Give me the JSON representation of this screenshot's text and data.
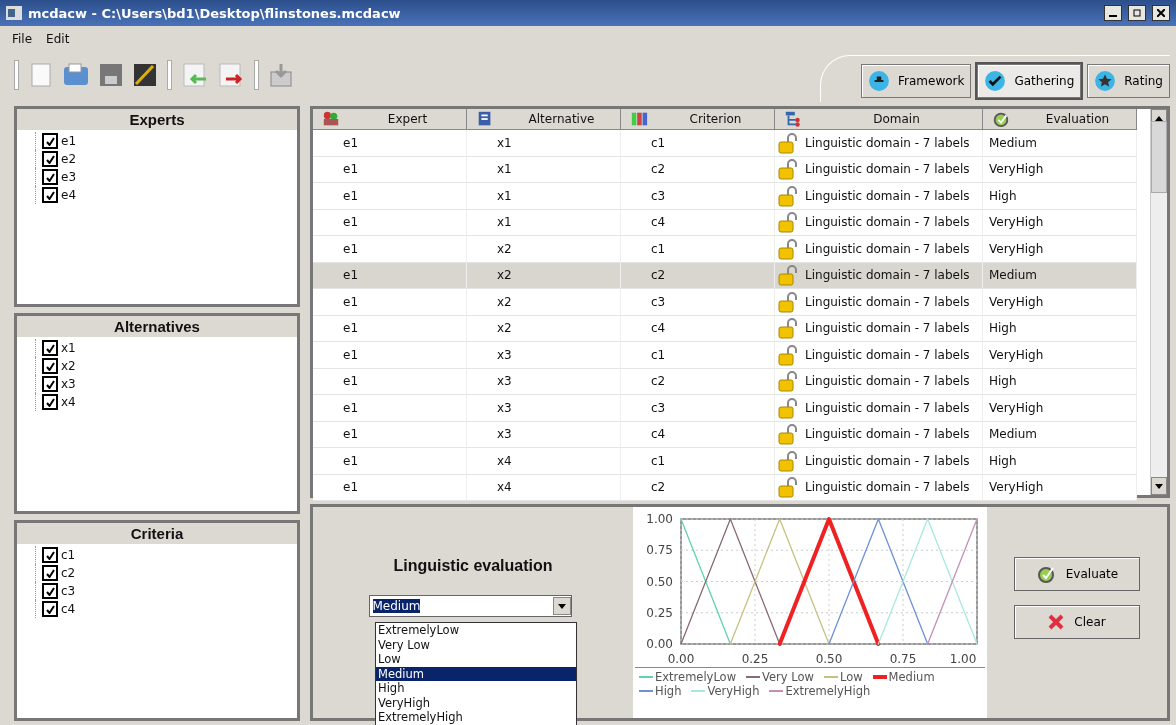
{
  "window": {
    "title": "mcdacw - C:\\Users\\bd1\\Desktop\\flinstones.mcdacw"
  },
  "menu": [
    "File",
    "Edit"
  ],
  "mode_tabs": [
    {
      "label": "Framework",
      "kind": "framework",
      "selected": false
    },
    {
      "label": "Gathering",
      "kind": "gathering",
      "selected": true
    },
    {
      "label": "Rating",
      "kind": "rating",
      "selected": false
    }
  ],
  "panels": [
    {
      "title": "Experts",
      "items": [
        {
          "label": "e1",
          "checked": true
        },
        {
          "label": "e2",
          "checked": true
        },
        {
          "label": "e3",
          "checked": true
        },
        {
          "label": "e4",
          "checked": true
        }
      ]
    },
    {
      "title": "Alternatives",
      "items": [
        {
          "label": "x1",
          "checked": true
        },
        {
          "label": "x2",
          "checked": true
        },
        {
          "label": "x3",
          "checked": true
        },
        {
          "label": "x4",
          "checked": true
        }
      ]
    },
    {
      "title": "Criteria",
      "items": [
        {
          "label": "c1",
          "checked": true
        },
        {
          "label": "c2",
          "checked": true
        },
        {
          "label": "c3",
          "checked": true
        },
        {
          "label": "c4",
          "checked": true
        }
      ]
    }
  ],
  "table": {
    "columns": [
      {
        "label": "Expert",
        "kind": "expert"
      },
      {
        "label": "Alternative",
        "kind": "alternative"
      },
      {
        "label": "Criterion",
        "kind": "criterion"
      },
      {
        "label": "Domain",
        "kind": "domain"
      },
      {
        "label": "Evaluation",
        "kind": "evaluation"
      }
    ],
    "rows": [
      {
        "cells": [
          "e1",
          "x1",
          "c1",
          "Linguistic domain - 7 labels",
          "Medium"
        ],
        "selected": false
      },
      {
        "cells": [
          "e1",
          "x1",
          "c2",
          "Linguistic domain - 7 labels",
          "VeryHigh"
        ],
        "selected": false
      },
      {
        "cells": [
          "e1",
          "x1",
          "c3",
          "Linguistic domain - 7 labels",
          "High"
        ],
        "selected": false
      },
      {
        "cells": [
          "e1",
          "x1",
          "c4",
          "Linguistic domain - 7 labels",
          "VeryHigh"
        ],
        "selected": false
      },
      {
        "cells": [
          "e1",
          "x2",
          "c1",
          "Linguistic domain - 7 labels",
          "VeryHigh"
        ],
        "selected": false
      },
      {
        "cells": [
          "e1",
          "x2",
          "c2",
          "Linguistic domain - 7 labels",
          "Medium"
        ],
        "selected": true
      },
      {
        "cells": [
          "e1",
          "x2",
          "c3",
          "Linguistic domain - 7 labels",
          "VeryHigh"
        ],
        "selected": false
      },
      {
        "cells": [
          "e1",
          "x2",
          "c4",
          "Linguistic domain - 7 labels",
          "High"
        ],
        "selected": false
      },
      {
        "cells": [
          "e1",
          "x3",
          "c1",
          "Linguistic domain - 7 labels",
          "VeryHigh"
        ],
        "selected": false
      },
      {
        "cells": [
          "e1",
          "x3",
          "c2",
          "Linguistic domain - 7 labels",
          "High"
        ],
        "selected": false
      },
      {
        "cells": [
          "e1",
          "x3",
          "c3",
          "Linguistic domain - 7 labels",
          "VeryHigh"
        ],
        "selected": false
      },
      {
        "cells": [
          "e1",
          "x3",
          "c4",
          "Linguistic domain - 7 labels",
          "Medium"
        ],
        "selected": false
      },
      {
        "cells": [
          "e1",
          "x4",
          "c1",
          "Linguistic domain - 7 labels",
          "High"
        ],
        "selected": false
      },
      {
        "cells": [
          "e1",
          "x4",
          "c2",
          "Linguistic domain - 7 labels",
          "VeryHigh"
        ],
        "selected": false
      }
    ]
  },
  "evaluation": {
    "title": "Linguistic evaluation",
    "value": "Medium",
    "options": [
      {
        "label": "ExtremelyLow",
        "selected": false
      },
      {
        "label": "Very Low",
        "selected": false
      },
      {
        "label": "Low",
        "selected": false
      },
      {
        "label": "Medium",
        "selected": true
      },
      {
        "label": "High",
        "selected": false
      },
      {
        "label": "VeryHigh",
        "selected": false
      },
      {
        "label": "ExtremelyHigh",
        "selected": false
      }
    ],
    "chart_data": {
      "type": "line",
      "grid": true,
      "legend": true,
      "x": [
        0,
        0.1667,
        0.3333,
        0.5,
        0.6667,
        0.8333,
        1
      ],
      "xlim": [
        0,
        1
      ],
      "ylim": [
        0,
        1
      ],
      "xticks": [
        {
          "value": 0,
          "label": "0.00"
        },
        {
          "value": 0.25,
          "label": "0.25"
        },
        {
          "value": 0.5,
          "label": "0.50"
        },
        {
          "value": 0.75,
          "label": "0.75"
        },
        {
          "value": 1,
          "label": "1.00"
        }
      ],
      "yticks": [
        {
          "value": 0,
          "label": "0.00"
        },
        {
          "value": 0.25,
          "label": "0.25"
        },
        {
          "value": 0.5,
          "label": "0.50"
        },
        {
          "value": 0.75,
          "label": "0.75"
        },
        {
          "value": 1,
          "label": "1.00"
        }
      ],
      "series": [
        {
          "name": "ExtremelyLow",
          "color": "#5fd3b0",
          "values": [
            1,
            0,
            null,
            null,
            null,
            null,
            null
          ]
        },
        {
          "name": "Very Low",
          "color": "#8a6a72",
          "values": [
            0,
            1,
            0,
            null,
            null,
            null,
            null
          ]
        },
        {
          "name": "Low",
          "color": "#c8c080",
          "values": [
            null,
            0,
            1,
            0,
            null,
            null,
            null
          ]
        },
        {
          "name": "Medium",
          "color": "#ee2222",
          "values": [
            null,
            null,
            0,
            1,
            0,
            null,
            null
          ]
        },
        {
          "name": "High",
          "color": "#6f8fd8",
          "values": [
            null,
            null,
            null,
            0,
            1,
            0,
            null
          ]
        },
        {
          "name": "VeryHigh",
          "color": "#a8e8e0",
          "values": [
            null,
            null,
            null,
            null,
            0,
            1,
            0
          ]
        },
        {
          "name": "ExtremelyHigh",
          "color": "#c090b8",
          "values": [
            null,
            null,
            null,
            null,
            null,
            0,
            1
          ]
        }
      ]
    },
    "buttons": [
      {
        "label": "Evaluate",
        "kind": "evaluate"
      },
      {
        "label": "Clear",
        "kind": "clear"
      }
    ]
  }
}
